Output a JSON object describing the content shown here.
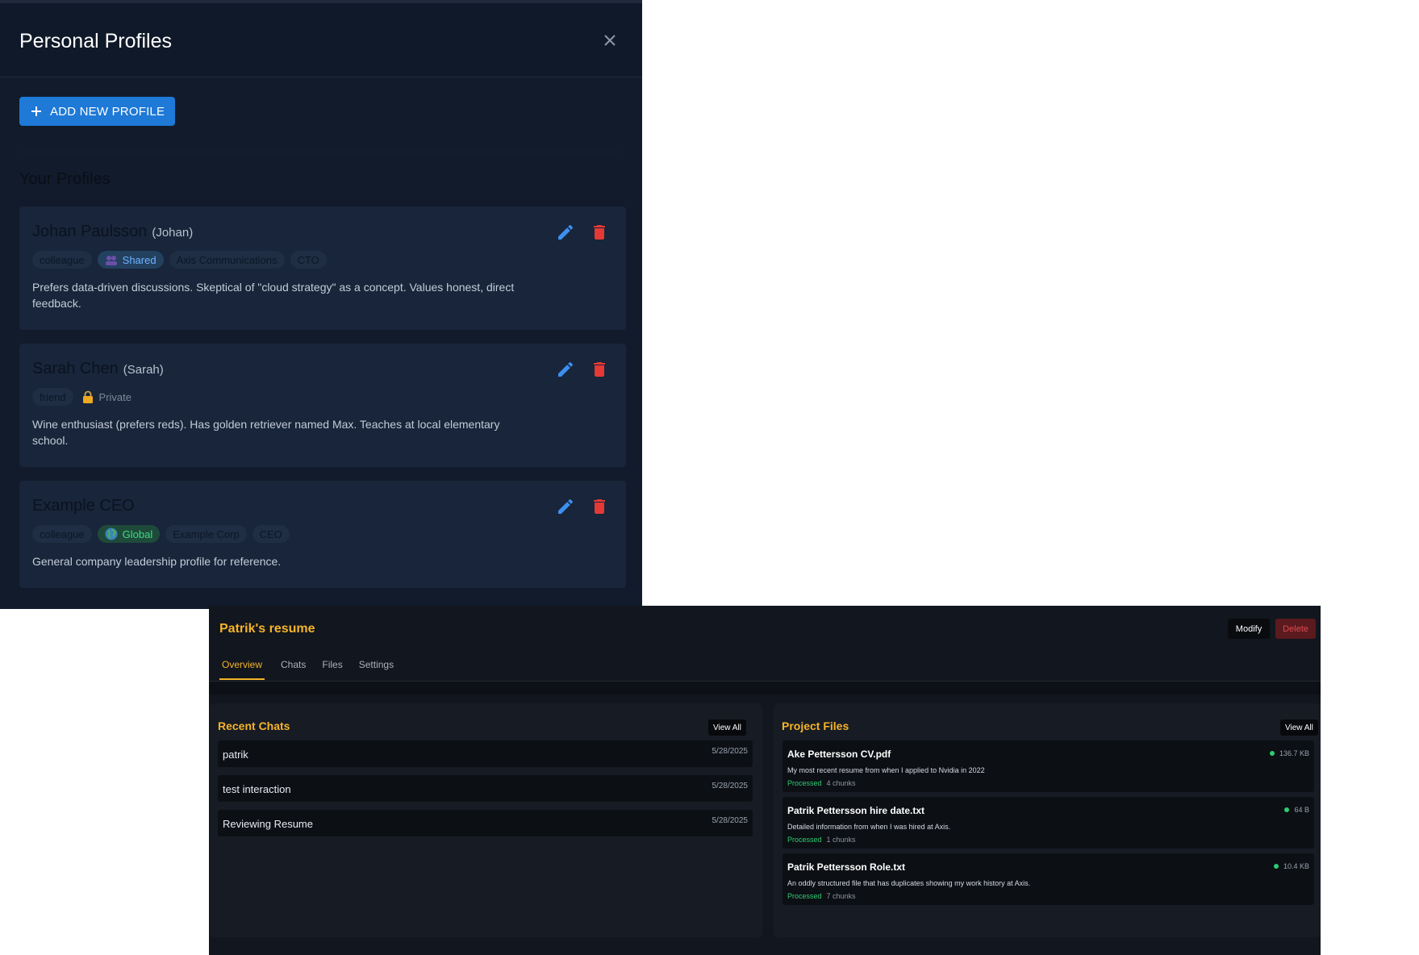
{
  "profiles_modal": {
    "title": "Personal Profiles",
    "close_icon": "close-icon",
    "add_button_label": "ADD NEW PROFILE",
    "section_title": "Your Profiles",
    "profiles": [
      {
        "name": "Johan Paulsson",
        "nickname": "(Johan)",
        "tags": [
          "colleague",
          "Axis Communications",
          "CTO"
        ],
        "visibility": "Shared",
        "description": "Prefers data-driven discussions. Skeptical of \"cloud strategy\" as a concept. Values honest, direct feedback."
      },
      {
        "name": "Sarah Chen",
        "nickname": "(Sarah)",
        "tags": [
          "friend"
        ],
        "visibility": "Private",
        "description": "Wine enthusiast (prefers reds). Has golden retriever named Max. Teaches at local elementary school."
      },
      {
        "name": "Example CEO",
        "nickname": "",
        "tags": [
          "colleague",
          "Example Corp",
          "CEO"
        ],
        "visibility": "Global",
        "description": "General company leadership profile for reference."
      }
    ]
  },
  "project": {
    "title": "Patrik's resume",
    "modify_label": "Modify",
    "delete_label": "Delete",
    "tabs": [
      "Overview",
      "Chats",
      "Files",
      "Settings"
    ],
    "active_tab": "Overview",
    "recent_chats": {
      "title": "Recent Chats",
      "view_all": "View All",
      "items": [
        {
          "name": "patrik",
          "date": "5/28/2025"
        },
        {
          "name": "test interaction",
          "date": "5/28/2025"
        },
        {
          "name": "Reviewing Resume",
          "date": "5/28/2025"
        }
      ]
    },
    "project_files": {
      "title": "Project Files",
      "view_all": "View All",
      "items": [
        {
          "name": "Ake Pettersson CV.pdf",
          "size": "136.7 KB",
          "description": "My most recent resume from when I applied to Nvidia in 2022",
          "status": "Processed",
          "chunks": "4 chunks"
        },
        {
          "name": "Patrik Pettersson hire date.txt",
          "size": "64 B",
          "description": "Detailed information from when I was hired at Axis.",
          "status": "Processed",
          "chunks": "1 chunks"
        },
        {
          "name": "Patrik Pettersson Role.txt",
          "size": "10.4 KB",
          "description": "An oddly structured file that has duplicates showing my work history at Axis.",
          "status": "Processed",
          "chunks": "7 chunks"
        }
      ]
    }
  },
  "colors": {
    "accent_blue": "#1e79d7",
    "accent_orange": "#f5b42a",
    "danger_red": "#e53935",
    "status_green": "#2ecc71"
  }
}
